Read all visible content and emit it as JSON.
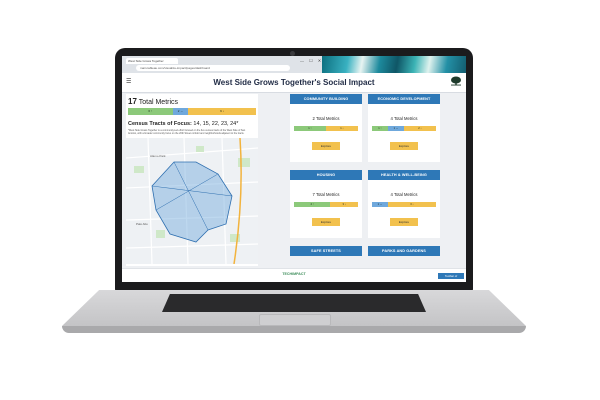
{
  "browser": {
    "tab_title": "West Side Grows Together",
    "url": "main.tableau.com/visualize-impact/pages/dashboard",
    "window_controls": "— ☐ ✕"
  },
  "app": {
    "menu_icon": "hamburger-menu-icon",
    "title": "West Side Grows Together's Social Impact",
    "logo_icon": "tree-logo-icon"
  },
  "summary": {
    "total_count": "17",
    "total_label": "Total Metrics",
    "bar": [
      {
        "label": "6 ↑",
        "color": "#8cc97a",
        "share": 0.35
      },
      {
        "label": "2 ↔",
        "color": "#6fa8dc",
        "share": 0.12
      },
      {
        "label": "9 ↓",
        "color": "#f2c14e",
        "share": 0.53
      }
    ],
    "census_label": "Census Tracts of Focus:",
    "census_tracts": "14, 15, 22, 23, 24*",
    "paragraph": "*West Side Grows Together is a community-led effort focused on the five census tracts of the West Side of San Antonio, with a broader community focus on the 20th Street corridor and neighborhoods adjacent to the tracts."
  },
  "map": {
    "label_1": "Alamo Park",
    "label_2": "Palo Alto"
  },
  "cards": [
    {
      "title": "COMMUNITY BUILDING",
      "total": "2 Total Metrics",
      "explore": "Explore",
      "bar": [
        {
          "label": "1 ↑",
          "color": "#8cc97a",
          "share": 0.5
        },
        {
          "label": "1 ↓",
          "color": "#f2c14e",
          "share": 0.5
        }
      ]
    },
    {
      "title": "ECONOMIC DEVELOPMENT",
      "total": "4 Total Metrics",
      "explore": "Explore",
      "bar": [
        {
          "label": "1 ↑",
          "color": "#8cc97a",
          "share": 0.25
        },
        {
          "label": "1 ↔",
          "color": "#6fa8dc",
          "share": 0.25
        },
        {
          "label": "2 ↓",
          "color": "#f2c14e",
          "share": 0.5
        }
      ]
    },
    {
      "title": "HOUSING",
      "total": "7 Total Metrics",
      "explore": "Explore",
      "bar": [
        {
          "label": "4 ↑",
          "color": "#8cc97a",
          "share": 0.57
        },
        {
          "label": "3 ↓",
          "color": "#f2c14e",
          "share": 0.43
        }
      ]
    },
    {
      "title": "HEALTH & WELL-BEING",
      "total": "4 Total Metrics",
      "explore": "Explore",
      "bar": [
        {
          "label": "1 ↔",
          "color": "#6fa8dc",
          "share": 0.25
        },
        {
          "label": "3 ↓",
          "color": "#f2c14e",
          "share": 0.75
        }
      ]
    },
    {
      "title": "SAFE STREETS",
      "total": "",
      "explore": "",
      "bar": []
    },
    {
      "title": "PARKS AND GARDENS",
      "total": "",
      "explore": "",
      "bar": []
    }
  ],
  "footer": {
    "logo_text": "TECHIMPACT",
    "button": "Toolbar of Dashboard"
  },
  "colors": {
    "accent": "#2e78b7",
    "improve": "#8cc97a",
    "steady": "#6fa8dc",
    "decline": "#f2c14e"
  }
}
